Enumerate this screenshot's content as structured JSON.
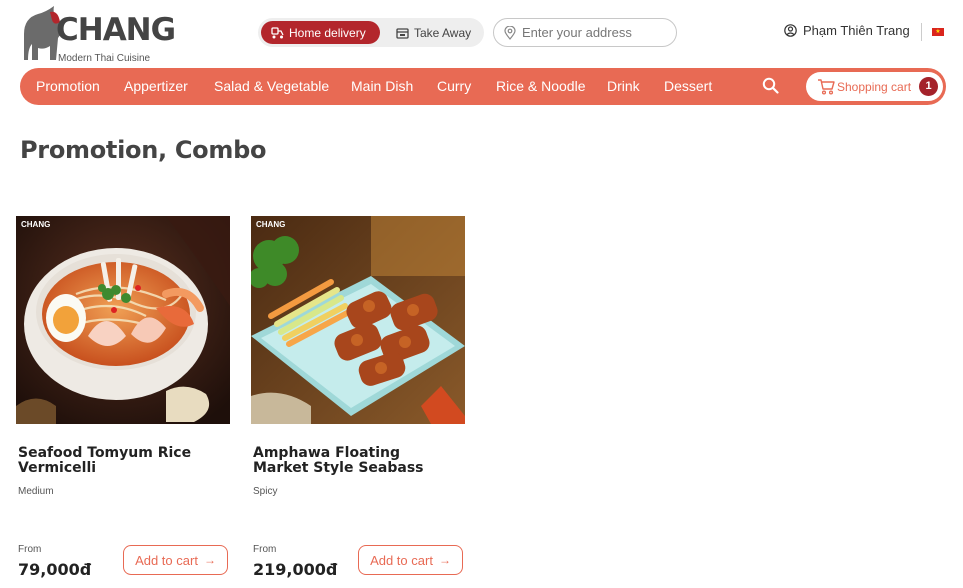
{
  "brand": {
    "name": "CHANG",
    "tagline": "Modern Thai Cuisine",
    "image_logo_text": "CHANG"
  },
  "header": {
    "delivery_options": [
      {
        "label": "Home delivery",
        "active": true,
        "icon": "scooter-icon"
      },
      {
        "label": "Take Away",
        "active": false,
        "icon": "store-icon"
      }
    ],
    "address_placeholder": "Enter your address",
    "user_name": "Phạm Thiên Trang",
    "language_flag": "vietnam-flag-icon"
  },
  "nav": {
    "items": [
      {
        "label": "Promotion"
      },
      {
        "label": "Appertizer"
      },
      {
        "label": "Salad & Vegetable"
      },
      {
        "label": "Main Dish"
      },
      {
        "label": "Curry"
      },
      {
        "label": "Rice & Noodle"
      },
      {
        "label": "Drink"
      },
      {
        "label": "Dessert"
      }
    ],
    "cart_label": "Shopping cart",
    "cart_count": "1"
  },
  "page": {
    "title": "Promotion, Combo"
  },
  "products": [
    {
      "name": "Seafood Tomyum Rice Vermicelli",
      "tag": "Medium",
      "from_label": "From",
      "price": "79,000đ",
      "button_label": "Add to cart"
    },
    {
      "name": "Amphawa Floating Market Style Seabass",
      "tag": "Spicy",
      "from_label": "From",
      "price": "219,000đ",
      "button_label": "Add to cart"
    }
  ],
  "colors": {
    "accent": "#e86a54",
    "active_toggle": "#b3262c",
    "badge": "#a4222a"
  }
}
